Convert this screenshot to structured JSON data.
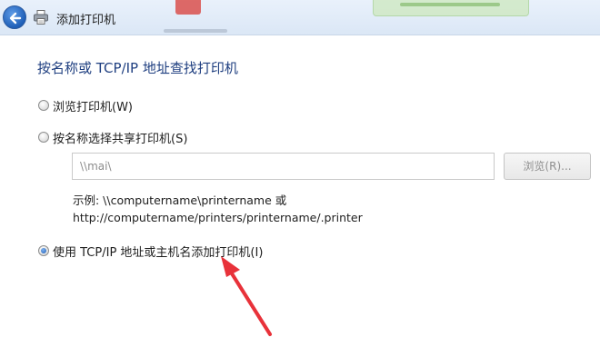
{
  "window": {
    "title": "添加打印机"
  },
  "page": {
    "heading": "按名称或 TCP/IP 地址查找打印机"
  },
  "options": [
    {
      "label": "浏览打印机(W)",
      "selected": false
    },
    {
      "label": "按名称选择共享打印机(S)",
      "selected": false
    },
    {
      "label": "使用 TCP/IP 地址或主机名添加打印机(I)",
      "selected": true
    }
  ],
  "shared_printer": {
    "value": "\\\\mai\\",
    "browse_label": "浏览(R)..."
  },
  "example": {
    "line1": "示例: \\\\computername\\printername 或",
    "line2": "http://computername/printers/printername/.printer"
  },
  "annotation": {
    "arrow_color": "#e8323a"
  },
  "icons": {
    "back": "back-arrow-icon",
    "printer": "printer-icon"
  }
}
